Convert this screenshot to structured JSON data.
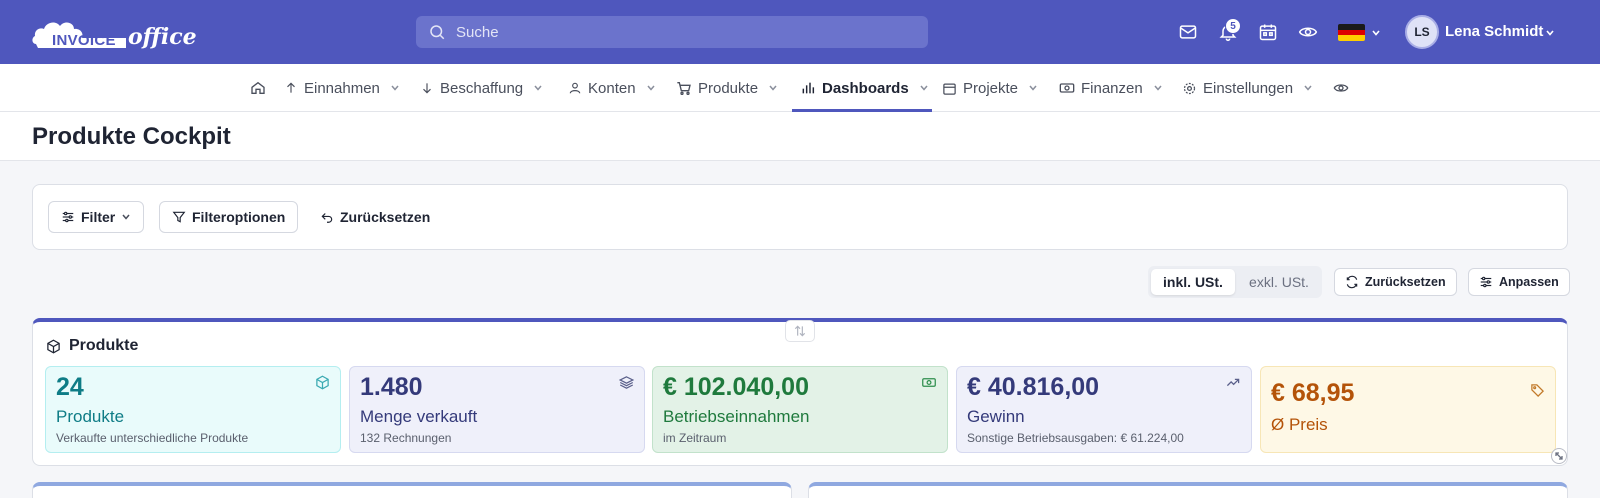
{
  "topbar": {
    "logo_main": "INVOICE",
    "logo_script": "office",
    "search_placeholder": "Suche",
    "notification_count": "5",
    "user_initials": "LS",
    "user_name": "Lena Schmidt",
    "icons": [
      "mail-icon",
      "bell-icon",
      "calendar-icon",
      "eye-icon",
      "flag-de-icon",
      "chevron-down-icon"
    ]
  },
  "nav": {
    "items": [
      {
        "label": "Einnahmen",
        "icon": "arrow-up-icon"
      },
      {
        "label": "Beschaffung",
        "icon": "arrow-down-icon"
      },
      {
        "label": "Konten",
        "icon": "user-icon"
      },
      {
        "label": "Produkte",
        "icon": "cart-icon"
      },
      {
        "label": "Dashboards",
        "icon": "bar-chart-icon",
        "active": true
      },
      {
        "label": "Projekte",
        "icon": "calendar-icon"
      },
      {
        "label": "Finanzen",
        "icon": "money-icon"
      },
      {
        "label": "Einstellungen",
        "icon": "gear-icon"
      }
    ]
  },
  "page": {
    "title": "Produkte Cockpit"
  },
  "filters": {
    "filter_label": "Filter",
    "options_label": "Filteroptionen",
    "reset_label": "Zurücksetzen"
  },
  "toolbar": {
    "vat_incl": "inkl. USt.",
    "vat_excl": "exkl. USt.",
    "reset_label": "Zurücksetzen",
    "customize_label": "Anpassen"
  },
  "widget": {
    "title": "Produkte",
    "kpis": [
      {
        "value": "24",
        "label": "Produkte",
        "sub": "Verkaufte unterschiedliche Produkte",
        "icon": "cube-icon",
        "color": "#0e7c86"
      },
      {
        "value": "1.480",
        "label": "Menge verkauft",
        "sub": "132 Rechnungen",
        "icon": "layers-icon",
        "color": "#343a7a"
      },
      {
        "value": "€ 102.040,00",
        "label": "Betriebseinnahmen",
        "sub": "im Zeitraum",
        "icon": "banknote-icon",
        "color": "#1f7a3d"
      },
      {
        "value": "€ 40.816,00",
        "label": "Gewinn",
        "sub": "Sonstige Betriebsausgaben: € 61.224,00",
        "icon": "trend-up-icon",
        "color": "#343a7a"
      },
      {
        "value": "€ 68,95",
        "label": "Ø Preis",
        "sub": "",
        "icon": "tag-icon",
        "color": "#b45309"
      }
    ]
  }
}
